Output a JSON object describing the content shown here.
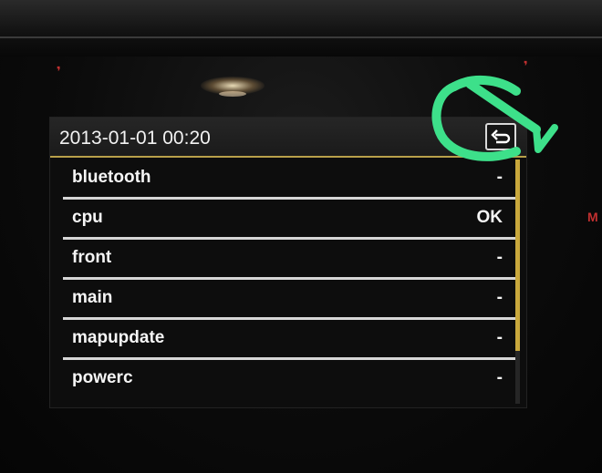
{
  "header": {
    "datetime": "2013-01-01 00:20",
    "back_icon": "back-arrow-icon"
  },
  "list": {
    "items": [
      {
        "label": "bluetooth",
        "status": "-"
      },
      {
        "label": "cpu",
        "status": "OK"
      },
      {
        "label": "front",
        "status": "-"
      },
      {
        "label": "main",
        "status": "-"
      },
      {
        "label": "mapupdate",
        "status": "-"
      },
      {
        "label": "powerc",
        "status": "-"
      }
    ]
  },
  "bezel": {
    "marks": [
      "M"
    ]
  },
  "colors": {
    "accent": "#b8a04a",
    "annotation": "#3de08a",
    "bezel_marks": "#c23030"
  }
}
